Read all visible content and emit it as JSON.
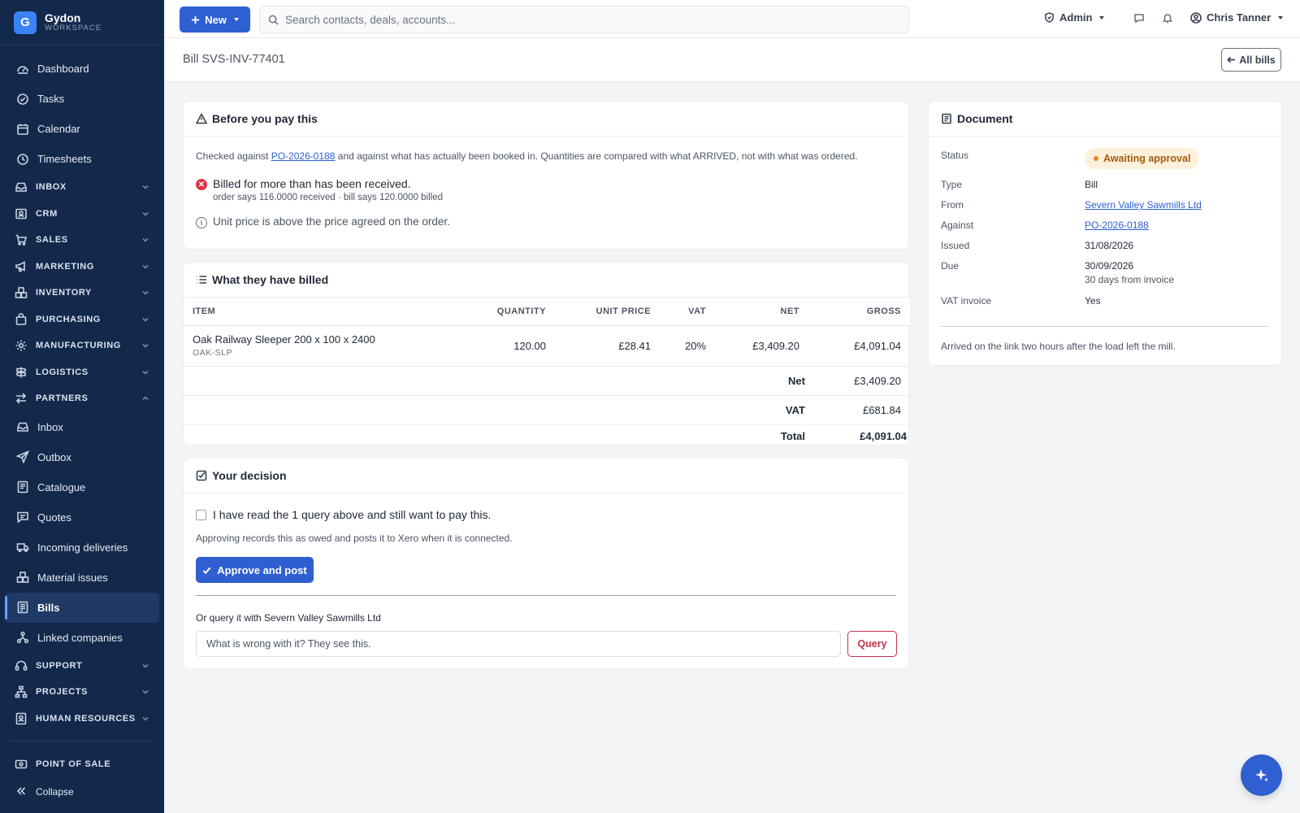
{
  "brand": {
    "name": "Gydon",
    "sub": "WORKSPACE",
    "logo_letter": "G"
  },
  "sidebar": {
    "items": [
      {
        "label": "Dashboard",
        "icon": "gauge-icon",
        "type": "item"
      },
      {
        "label": "Tasks",
        "icon": "check-circle-icon",
        "type": "item"
      },
      {
        "label": "Calendar",
        "icon": "calendar-icon",
        "type": "item"
      },
      {
        "label": "Timesheets",
        "icon": "clock-icon",
        "type": "item"
      },
      {
        "label": "INBOX",
        "icon": "inbox-icon",
        "type": "section"
      },
      {
        "label": "CRM",
        "icon": "contact-card-icon",
        "type": "section"
      },
      {
        "label": "SALES",
        "icon": "cart-icon",
        "type": "section"
      },
      {
        "label": "MARKETING",
        "icon": "megaphone-icon",
        "type": "section"
      },
      {
        "label": "INVENTORY",
        "icon": "boxes-icon",
        "type": "section"
      },
      {
        "label": "PURCHASING",
        "icon": "bag-icon",
        "type": "section"
      },
      {
        "label": "MANUFACTURING",
        "icon": "gear-icon",
        "type": "section"
      },
      {
        "label": "LOGISTICS",
        "icon": "signpost-icon",
        "type": "section"
      },
      {
        "label": "PARTNERS",
        "icon": "swap-icon",
        "type": "section-open"
      },
      {
        "label": "Inbox",
        "icon": "inbox-icon",
        "type": "item"
      },
      {
        "label": "Outbox",
        "icon": "send-icon",
        "type": "item"
      },
      {
        "label": "Catalogue",
        "icon": "catalogue-icon",
        "type": "item"
      },
      {
        "label": "Quotes",
        "icon": "message-square-icon",
        "type": "item"
      },
      {
        "label": "Incoming deliveries",
        "icon": "truck-icon",
        "type": "item"
      },
      {
        "label": "Material issues",
        "icon": "boxes-icon",
        "type": "item"
      },
      {
        "label": "Bills",
        "icon": "receipt-icon",
        "type": "item-active"
      },
      {
        "label": "Linked companies",
        "icon": "network-icon",
        "type": "item"
      },
      {
        "label": "SUPPORT",
        "icon": "headset-icon",
        "type": "section"
      },
      {
        "label": "PROJECTS",
        "icon": "hierarchy-icon",
        "type": "section"
      },
      {
        "label": "HUMAN RESOURCES",
        "icon": "id-badge-icon",
        "type": "section"
      }
    ],
    "point_of_sale": "POINT OF SALE",
    "collapse": "Collapse"
  },
  "topbar": {
    "new_label": "New",
    "search_placeholder": "Search contacts, deals, accounts...",
    "admin_label": "Admin",
    "user_name": "Chris Tanner"
  },
  "page": {
    "title": "Bill SVS-INV-77401",
    "back_label": "All bills"
  },
  "checks": {
    "heading": "Before you pay this",
    "intro_prefix": "Checked against ",
    "intro_link": "PO-2026-0188",
    "intro_suffix": " and against what has actually been booked in. Quantities are compared with what ARRIVED, not with what was ordered.",
    "error_title": "Billed for more than has been received.",
    "error_detail": "order says 116.0000 received · bill says 120.0000 billed",
    "info_text": "Unit price is above the price agreed on the order."
  },
  "billed": {
    "heading": "What they have billed",
    "columns": [
      "ITEM",
      "QUANTITY",
      "UNIT PRICE",
      "VAT",
      "NET",
      "GROSS"
    ],
    "lines": [
      {
        "name": "Oak Railway Sleeper 200 x 100 x 2400",
        "code": "OAK-SLP",
        "quantity": "120.00",
        "unit_price": "£28.41",
        "vat": "20%",
        "net": "£3,409.20",
        "gross": "£4,091.04"
      }
    ],
    "totals": {
      "net_label": "Net",
      "net_value": "£3,409.20",
      "vat_label": "VAT",
      "vat_value": "£681.84",
      "total_label": "Total",
      "total_value": "£4,091.04"
    }
  },
  "decision": {
    "heading": "Your decision",
    "confirm_text": "I have read the 1 query above and still want to pay this.",
    "note": "Approving records this as owed and posts it to Xero when it is connected.",
    "approve_label": "Approve and post",
    "query_label": "Or query it with Severn Valley Sawmills Ltd",
    "query_placeholder": "What is wrong with it? They see this.",
    "query_button": "Query"
  },
  "document": {
    "heading": "Document",
    "status_label": "Status",
    "status_value": "Awaiting approval",
    "type_label": "Type",
    "type_value": "Bill",
    "from_label": "From",
    "from_value": "Severn Valley Sawmills Ltd",
    "against_label": "Against",
    "against_value": "PO-2026-0188",
    "issued_label": "Issued",
    "issued_value": "31/08/2026",
    "due_label": "Due",
    "due_value": "30/09/2026",
    "due_sub": "30 days from invoice",
    "vat_label": "VAT invoice",
    "vat_value": "Yes",
    "note": "Arrived on the link two hours after the load left the mill."
  },
  "colors": {
    "sidebar_bg": "#13294b",
    "accent": "#2f5fd0",
    "error": "#dc3545",
    "warning_badge_bg": "#fdf1dc",
    "warning_badge_text": "#a35d10",
    "query_red": "#c0344b"
  }
}
